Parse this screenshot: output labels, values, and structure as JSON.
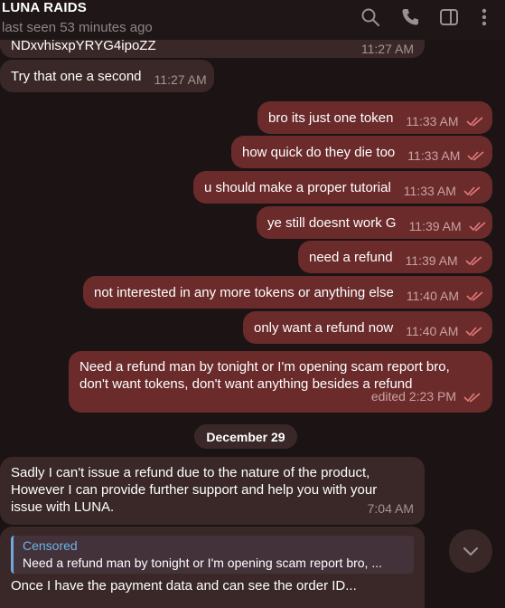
{
  "header": {
    "title": "LUNA RAIDS",
    "status": "last seen 53 minutes ago",
    "icons": [
      "search-icon",
      "phone-icon",
      "sidebar-icon",
      "more-icon"
    ]
  },
  "messages": [
    {
      "side": "in",
      "text": "NDxvhisxpYRYG4ipoZZ",
      "time": "11:27 AM"
    },
    {
      "side": "in",
      "text": "Try that one a second",
      "time": "11:27 AM"
    },
    {
      "side": "out",
      "text": "bro its just one token",
      "time": "11:33 AM"
    },
    {
      "side": "out",
      "text": "how quick do they die too",
      "time": "11:33 AM"
    },
    {
      "side": "out",
      "text": "u should make a proper tutorial",
      "time": "11:33 AM"
    },
    {
      "side": "out",
      "text": "ye still doesnt work G",
      "time": "11:39 AM"
    },
    {
      "side": "out",
      "text": "need a refund",
      "time": "11:39 AM"
    },
    {
      "side": "out",
      "text": "not interested in any more tokens or anything else",
      "time": "11:40 AM"
    },
    {
      "side": "out",
      "text": "only want a refund now",
      "time": "11:40 AM"
    },
    {
      "side": "out",
      "text": "Need a refund man by tonight or I'm opening scam report bro, don't want tokens, don't want anything besides a refund",
      "time": "edited 2:23 PM"
    },
    {
      "side": "in",
      "text": "Sadly I can't issue a refund due to the nature of the product, However I can provide further support and help you with your issue with LUNA.",
      "time": "7:04 AM"
    },
    {
      "side": "in",
      "reply_author": "Censored",
      "reply_text": "Need a refund man by tonight or I'm opening scam report bro, ...",
      "text": "Once I have the payment data and can see the order ID..."
    }
  ],
  "date_separator": "December 29",
  "colors": {
    "background": "#1c1414",
    "incoming": "#3a2828",
    "outgoing": "#6b2b2b",
    "check": "#e07a7a",
    "reply_accent": "#6fa8dc"
  }
}
